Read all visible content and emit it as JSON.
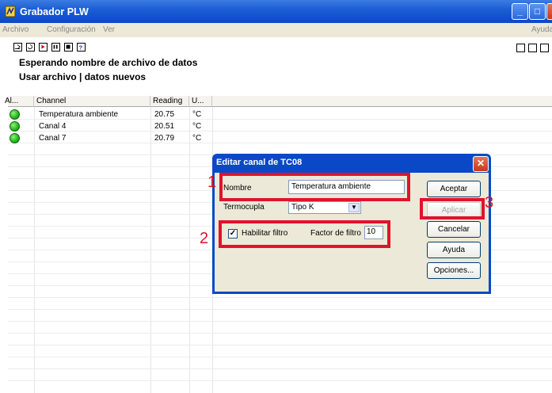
{
  "window": {
    "title": "Grabador PLW"
  },
  "menu": {
    "archivo": "Archivo",
    "configuracion": "Configuración",
    "ver": "Ver",
    "ayuda": "Ayuda"
  },
  "status": {
    "line1": "Esperando nombre de archivo de datos",
    "line2": "Usar archivo | datos nuevos"
  },
  "grid": {
    "columns": [
      "Al...",
      "Channel",
      "Reading",
      "U..."
    ],
    "rows": [
      {
        "channel": "Temperatura ambiente",
        "reading": "20.75",
        "unit": "°C"
      },
      {
        "channel": "Canal 4",
        "reading": "20.51",
        "unit": "°C"
      },
      {
        "channel": "Canal 7",
        "reading": "20.79",
        "unit": "°C"
      }
    ]
  },
  "dialog": {
    "title": "Editar canal de TC08",
    "nombre_label": "Nombre",
    "nombre_value": "Temperatura ambiente",
    "termocupla_label": "Termocupla",
    "termocupla_value": "Tipo K",
    "filtro_label": "Habilitar filtro",
    "filtro_checked": true,
    "factor_label": "Factor de filtro",
    "factor_value": "10",
    "buttons": {
      "aceptar": "Aceptar",
      "aplicar": "Aplicar",
      "cancelar": "Cancelar",
      "ayuda": "Ayuda",
      "opciones": "Opciones..."
    }
  },
  "annotations": {
    "m1": "1",
    "m2": "2",
    "m3": "3"
  },
  "colors": {
    "titlebar": "#0a49c6",
    "highlight": "#e0132b",
    "alarm_ok": "#1fb81a"
  }
}
